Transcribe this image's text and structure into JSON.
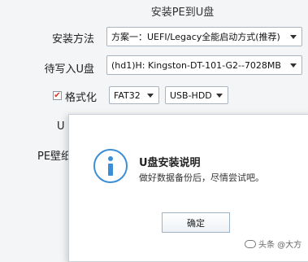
{
  "window": {
    "title": "安装PE到U盘"
  },
  "form": {
    "method_label": "安装方法",
    "method_value": "方案一：UEFI/Legacy全能启动方式(推荐)",
    "drive_label": "待写入U盘",
    "drive_value": "(hd1)H: Kingston-DT-101-G2--7028MB",
    "format_checkbox_checked": true,
    "format_label": "格式化",
    "filesystem_value": "FAT32",
    "mode_value": "USB-HDD",
    "partial_label_1": "U",
    "partial_label_2": "PE壁纸"
  },
  "dialog": {
    "icon": "info-icon",
    "title": "U盘安装说明",
    "message": "做好数据备份后，尽情尝试吧。",
    "ok_label": "确定"
  },
  "watermark": {
    "text": "头条 @大方"
  },
  "colors": {
    "accent": "#3c8fd6",
    "check": "#d23a2a"
  }
}
